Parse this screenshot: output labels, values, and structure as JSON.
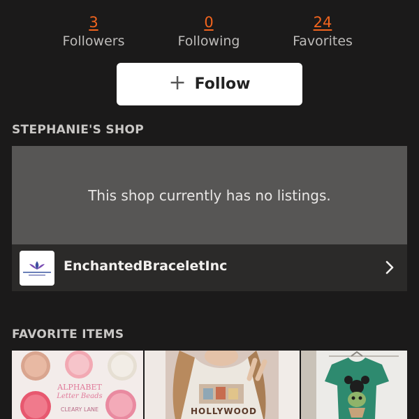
{
  "stats": {
    "followers": {
      "count": "3",
      "label": "Followers"
    },
    "following": {
      "count": "0",
      "label": "Following"
    },
    "favorites": {
      "count": "24",
      "label": "Favorites"
    }
  },
  "follow_button": {
    "icon": "plus-icon",
    "label": "Follow"
  },
  "shop_section": {
    "title": "STEPHANIE'S SHOP",
    "empty_message": "This shop currently has no listings.",
    "shop_name": "EnchantedBraceletInc",
    "chevron_icon": "chevron-right-icon"
  },
  "favorites_section": {
    "title": "FAVORITE ITEMS",
    "items": [
      {
        "image": "alphabet-letter-beads-product-image",
        "text_lines": [
          "ALPHABET",
          "Letter Beads",
          "CLEARY LANE"
        ]
      },
      {
        "image": "woman-disney-hollywood-tshirt-photo",
        "text_lines": [
          "HOLLYWOOD"
        ]
      },
      {
        "image": "green-character-tshirt-on-rack-photo"
      }
    ]
  },
  "colors": {
    "background": "#1b1a1a",
    "accent": "#f1641e",
    "button_bg": "#ffffff",
    "empty_panel": "#575655",
    "shop_row": "#2b2a29"
  }
}
